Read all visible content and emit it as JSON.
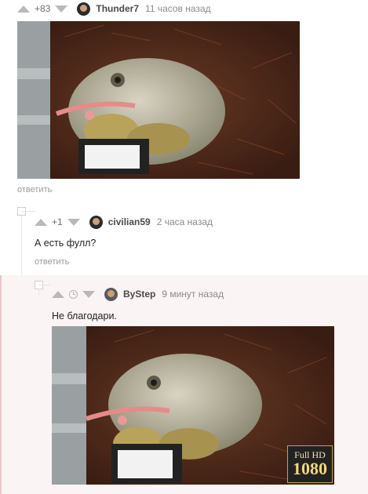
{
  "comment1": {
    "score": "+83",
    "username": "Thunder7",
    "time": "11 часов назад",
    "reply": "ответить"
  },
  "comment2": {
    "score": "+1",
    "username": "civilian59",
    "time": "2 часа назад",
    "text": "А есть фулл?",
    "reply": "ответить"
  },
  "comment3": {
    "username": "ByStep",
    "time": "9 минут назад",
    "text": "Не благодари.",
    "badge_top": "Full HD",
    "badge_bottom": "1080"
  },
  "colors": {
    "highlight_background": "#fbf4f4",
    "highlight_border": "#e9c7c7"
  }
}
